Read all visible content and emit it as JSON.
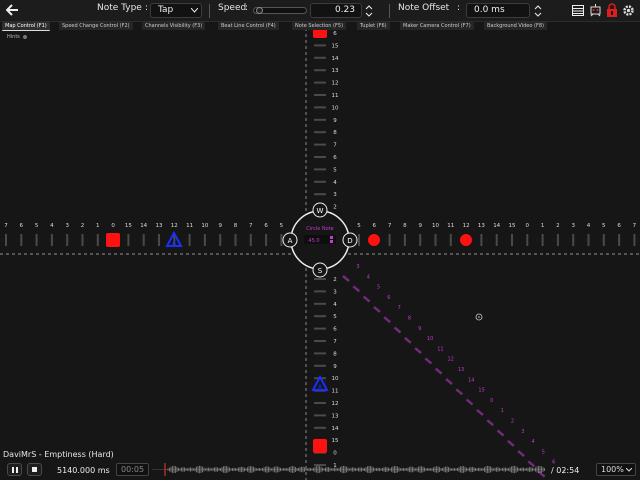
{
  "header": {
    "note_type_label": "Note Type",
    "note_type_value": "Tap",
    "speed_label": "Speed",
    "speed_value": "0.23",
    "note_offset_label": "Note Offset",
    "note_offset_value": "0.0 ms",
    "colon": ":"
  },
  "tabs": [
    {
      "label": "Map Control (F1)"
    },
    {
      "label": "Speed Change Control (F2)"
    },
    {
      "label": "Channels Visibility (F3)"
    },
    {
      "label": "Beat Line Control (F4)"
    },
    {
      "label": "Note Selection (F5)"
    },
    {
      "label": "Tuplet (F6)"
    },
    {
      "label": "Maker Camera Control (F7)"
    },
    {
      "label": "Background Video (F8)"
    }
  ],
  "hints_label": "Hints",
  "center": {
    "w": "W",
    "a": "A",
    "s": "S",
    "d": "D",
    "title": "Circle Note",
    "value": "45.0"
  },
  "axis_labels": {
    "left": [
      "7",
      "6",
      "5",
      "4",
      "3",
      "2",
      "1",
      "0",
      "15",
      "14",
      "13",
      "12",
      "11",
      "10",
      "9",
      "8",
      "7",
      "6",
      "5"
    ],
    "right": [
      "5",
      "6",
      "7",
      "8",
      "9",
      "10",
      "11",
      "12",
      "13",
      "14",
      "15",
      "0",
      "1",
      "2",
      "3",
      "4",
      "5",
      "6",
      "7"
    ],
    "top": [
      "6",
      "15",
      "14",
      "13",
      "12",
      "11",
      "10",
      "9",
      "8",
      "7",
      "6",
      "5",
      "4",
      "3",
      "2",
      "1",
      "0"
    ],
    "bottom": [
      "2",
      "3",
      "4",
      "5",
      "6",
      "7",
      "8",
      "9",
      "10",
      "11",
      "12",
      "13",
      "14",
      "15",
      "0",
      "1"
    ],
    "diagonal": [
      "3",
      "4",
      "5",
      "6",
      "7",
      "8",
      "9",
      "10",
      "11",
      "12",
      "13",
      "14",
      "15",
      "0",
      "1",
      "2",
      "3",
      "4",
      "5",
      "6",
      "7"
    ]
  },
  "bottom": {
    "song_title": "DaviMrS - Emptiness (Hard)",
    "time_ms": "5140.000 ms",
    "time_current": "00:05",
    "time_total": "/ 02:54",
    "zoom": "100%"
  },
  "colors": {
    "note_red": "#ff1111",
    "note_blue": "#1a2fff",
    "diagonal_magenta": "#c03cd0",
    "background": "#161616"
  },
  "icons": [
    "back-arrow-icon",
    "chevron-down-icon",
    "spinner-icon",
    "list-icon",
    "robot-icon",
    "lock-icon",
    "gear-icon",
    "pause-icon",
    "stop-icon",
    "target-icon"
  ]
}
